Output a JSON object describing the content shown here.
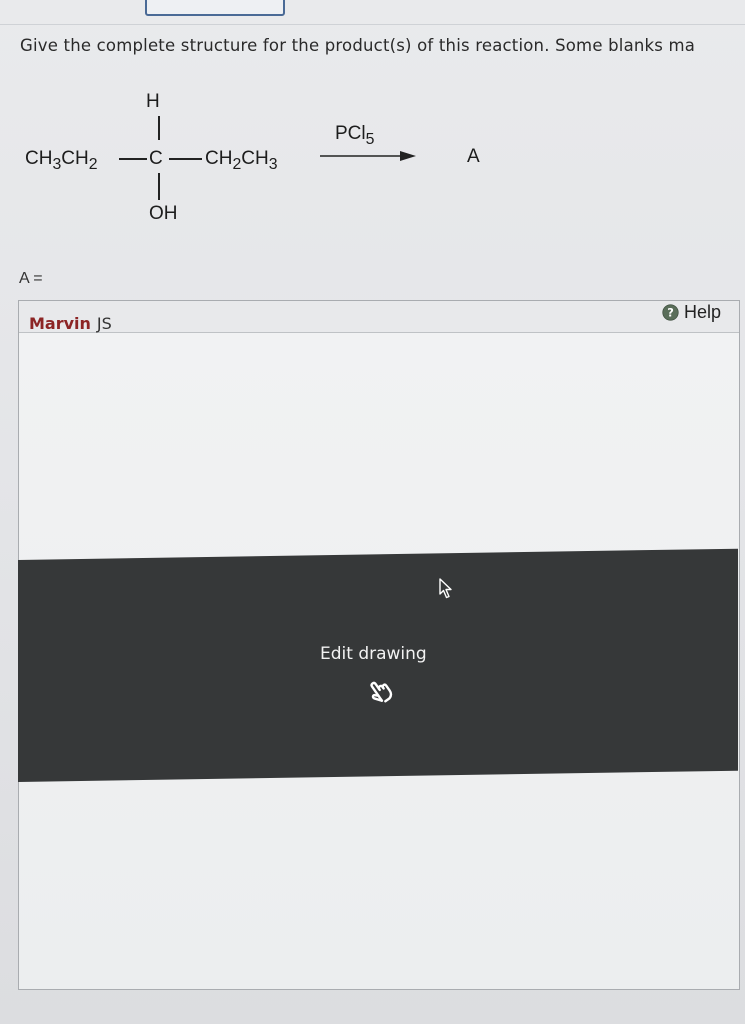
{
  "question": {
    "text": "Give the complete structure for the product(s) of this reaction. Some blanks ma"
  },
  "reaction": {
    "top_atom": "H",
    "left_group_html": "CH<sub>3</sub>CH<sub>2</sub>",
    "center_atom": "C",
    "right_group_html": "CH<sub>2</sub>CH<sub>3</sub>",
    "bottom_group": "OH",
    "reagent_html": "PCl<sub>5</sub>",
    "product": "A"
  },
  "answer": {
    "label": "A ="
  },
  "marvin": {
    "brand": "Marvin",
    "suffix": "JS",
    "help_label": "Help",
    "edit_label": "Edit drawing"
  }
}
